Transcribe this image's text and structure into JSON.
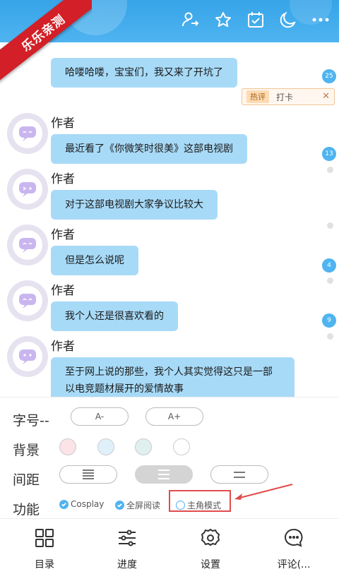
{
  "watermark": "乐乐亲测",
  "topbar": {
    "icons": [
      "user-switch-icon",
      "star-icon",
      "calendar-check-icon",
      "moon-icon",
      "more-icon"
    ]
  },
  "messages": [
    {
      "author": "作者",
      "text": "哈喽哈喽，宝宝们，我又来了开坑了"
    },
    {
      "author": "作者",
      "text": "最近看了《你微笑时很美》这部电视剧"
    },
    {
      "author": "作者",
      "text": "对于这部电视剧大家争议比较大"
    },
    {
      "author": "作者",
      "text": "但是怎么说呢"
    },
    {
      "author": "作者",
      "text": "我个人还是很喜欢看的"
    },
    {
      "author": "作者",
      "text": "至于网上说的那些，我个人其实觉得这只是一部以电竞题材展开的爱情故事"
    }
  ],
  "rail_counts": [
    "25",
    "13",
    "4",
    "9"
  ],
  "hot_comment": {
    "tag": "热评",
    "text": "打卡"
  },
  "settings": {
    "font_label": "字号--",
    "font_minus": "A-",
    "font_plus": "A+",
    "bg_label": "背景",
    "bg_colors": [
      "#fbe3e8",
      "#dff0fb",
      "#dff0ee",
      "#ffffff"
    ],
    "spacing_label": "间距",
    "func_label": "功能",
    "func_cosplay": "Cosplay",
    "func_fullscreen": "全屏阅读",
    "func_protagonist": "主角模式"
  },
  "bottom_nav": {
    "catalog": "目录",
    "progress": "进度",
    "settings": "设置",
    "comments": "评论(..."
  },
  "colors": {
    "accent": "#4fb4f0",
    "bubble": "#a7daf7",
    "highlight": "#e14b4b"
  }
}
